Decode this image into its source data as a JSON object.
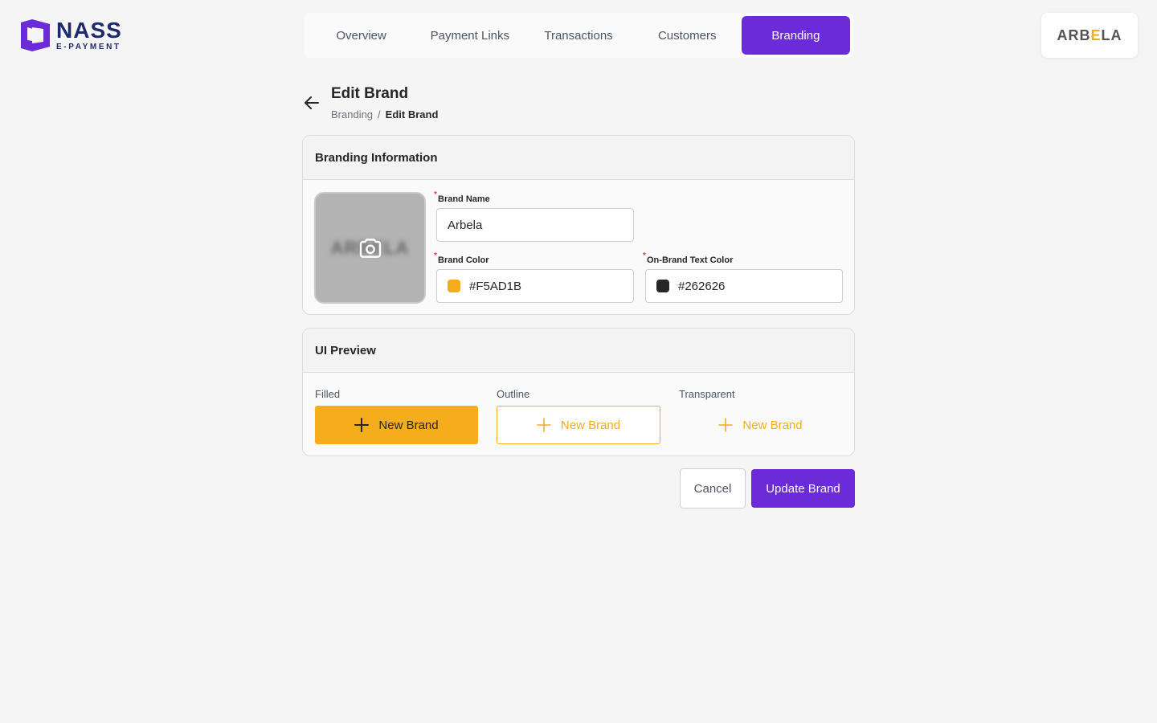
{
  "brand": {
    "name": "NASS",
    "subtitle": "E-PAYMENT"
  },
  "nav": {
    "items": [
      {
        "label": "Overview"
      },
      {
        "label": "Payment Links"
      },
      {
        "label": "Transactions"
      },
      {
        "label": "Customers"
      },
      {
        "label": "Branding",
        "active": true
      }
    ]
  },
  "merchant": {
    "logo_text_a": "ARB",
    "logo_text_e": "E",
    "logo_text_b": "LA"
  },
  "header": {
    "title": "Edit Brand",
    "breadcrumb": {
      "parent": "Branding",
      "separator": "/",
      "current": "Edit Brand"
    }
  },
  "branding_info": {
    "title": "Branding Information",
    "brand_name": {
      "label": "Brand Name",
      "value": "Arbela",
      "required": "*"
    },
    "brand_color": {
      "label": "Brand Color",
      "value": "#F5AD1B",
      "required": "*"
    },
    "text_color": {
      "label": "On-Brand Text Color",
      "value": "#262626",
      "required": "*"
    }
  },
  "ui_preview": {
    "title": "UI Preview",
    "filled": {
      "label": "Filled",
      "button": "New Brand"
    },
    "outline": {
      "label": "Outline",
      "button": "New Brand"
    },
    "transparent": {
      "label": "Transparent",
      "button": "New Brand"
    }
  },
  "actions": {
    "cancel": "Cancel",
    "update": "Update Brand"
  },
  "colors": {
    "accent": "#6C2BD9",
    "brand": "#F5AD1B",
    "text": "#262626"
  }
}
